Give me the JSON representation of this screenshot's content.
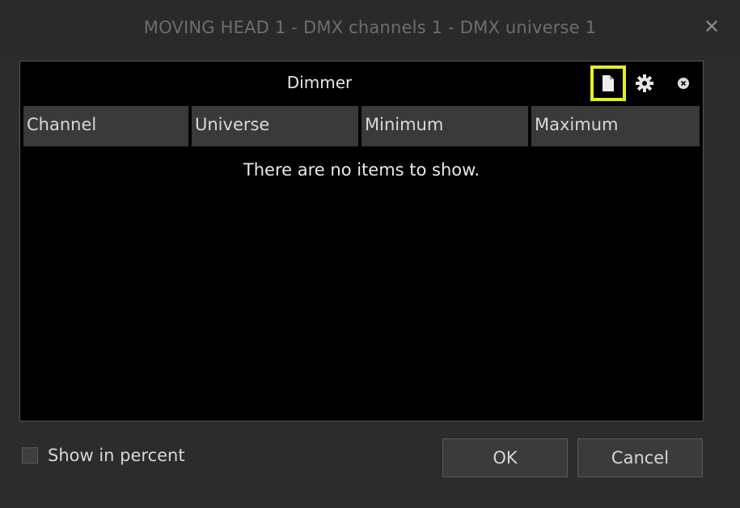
{
  "window": {
    "title": "MOVING HEAD  1 - DMX channels 1 - DMX universe 1",
    "close_glyph": "✕"
  },
  "panel": {
    "title": "Dimmer",
    "icons": {
      "new": "new-document-icon",
      "settings": "gear-icon",
      "remove": "close-icon"
    },
    "highlight_color": "#e5ef1f",
    "columns": [
      "Channel",
      "Universe",
      "Minimum",
      "Maximum"
    ],
    "empty_message": "There are no items to show."
  },
  "footer": {
    "show_percent_label": "Show in percent",
    "show_percent_checked": false,
    "ok_label": "OK",
    "cancel_label": "Cancel"
  }
}
